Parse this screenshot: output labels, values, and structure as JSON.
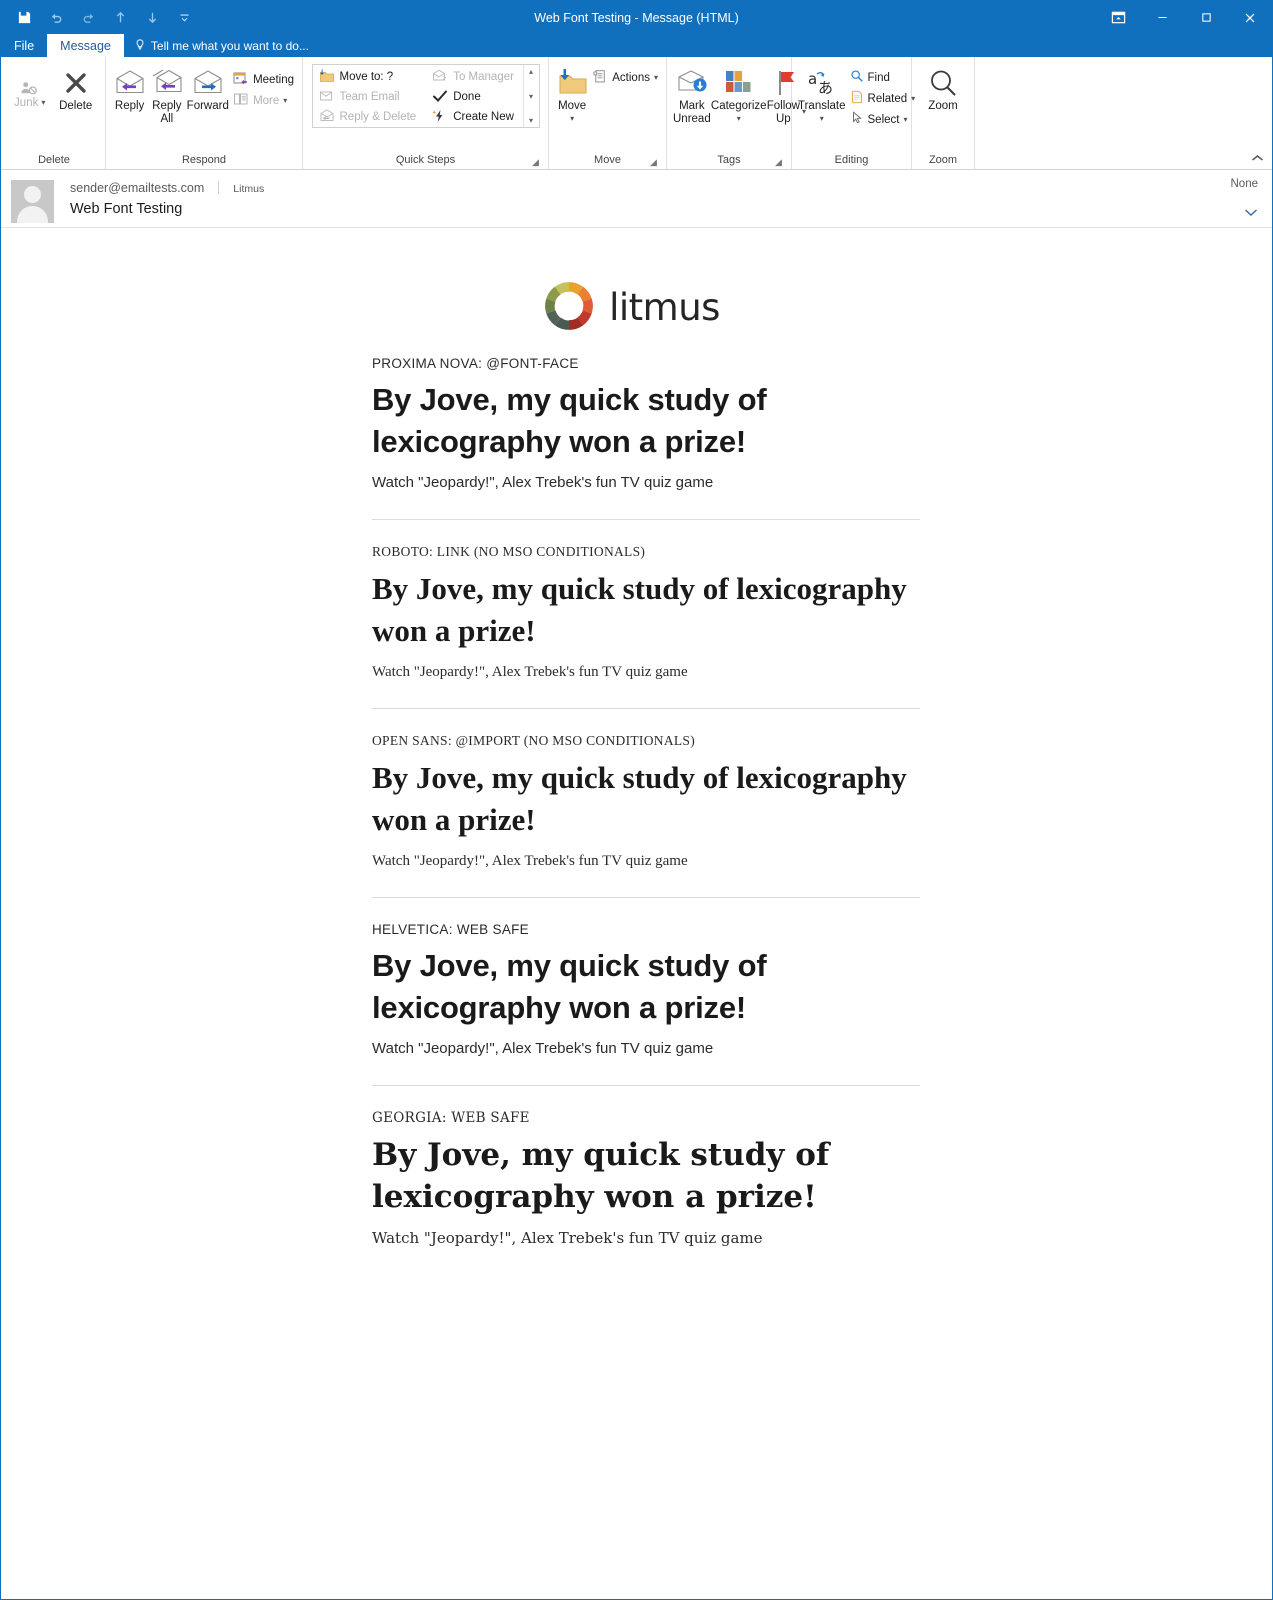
{
  "window": {
    "title": "Web Font Testing - Message (HTML)",
    "accent_color": "#1070bd"
  },
  "quick_access_toolbar": {
    "items": [
      {
        "name": "save-icon",
        "label": "Save"
      },
      {
        "name": "undo-icon",
        "label": "Undo"
      },
      {
        "name": "redo-icon",
        "label": "Redo"
      },
      {
        "name": "previous-item-icon",
        "label": "Previous Item"
      },
      {
        "name": "next-item-icon",
        "label": "Next Item"
      },
      {
        "name": "customize-qat-icon",
        "label": "Customize Quick Access Toolbar"
      }
    ]
  },
  "window_controls": {
    "restore_ribbon": "Ribbon Display Options",
    "minimize": "Minimize",
    "maximize": "Maximize",
    "close": "Close"
  },
  "tabs": [
    {
      "label": "File",
      "active": false
    },
    {
      "label": "Message",
      "active": true
    }
  ],
  "tell_me": {
    "placeholder": "Tell me what you want to do..."
  },
  "ribbon": {
    "collapse_label": "^",
    "groups": [
      {
        "name": "delete",
        "label": "Delete",
        "buttons": [
          {
            "label": "Junk",
            "icon": "junk-icon",
            "dimmed": true,
            "has_caret": true
          },
          {
            "label": "Delete",
            "icon": "delete-x-icon",
            "dimmed": false,
            "has_caret": false
          }
        ]
      },
      {
        "name": "respond",
        "label": "Respond",
        "buttons": [
          {
            "label": "Reply",
            "icon": "reply-icon"
          },
          {
            "label": "Reply\nAll",
            "icon": "reply-all-icon"
          },
          {
            "label": "Forward",
            "icon": "forward-icon"
          }
        ],
        "small_buttons": [
          {
            "label": "Meeting",
            "icon": "meeting-icon",
            "dimmed": false,
            "has_caret": false
          },
          {
            "label": "More",
            "icon": "more-icon",
            "dimmed": true,
            "has_caret": true
          }
        ]
      },
      {
        "name": "quick-steps",
        "label": "Quick Steps",
        "items_col1": [
          {
            "label": "Move to: ?",
            "icon": "move-to-folder-icon",
            "dimmed": false
          },
          {
            "label": "Team Email",
            "icon": "team-email-icon",
            "dimmed": true
          },
          {
            "label": "Reply & Delete",
            "icon": "reply-delete-icon",
            "dimmed": true
          }
        ],
        "items_col2": [
          {
            "label": "To Manager",
            "icon": "to-manager-icon",
            "dimmed": true
          },
          {
            "label": "Done",
            "icon": "done-check-icon",
            "dimmed": false
          },
          {
            "label": "Create New",
            "icon": "create-new-icon",
            "dimmed": false
          }
        ],
        "has_dialog_launcher": true
      },
      {
        "name": "move",
        "label": "Move",
        "buttons": [
          {
            "label": "Move",
            "icon": "move-folder-icon",
            "has_caret": true
          }
        ],
        "small_buttons": [
          {
            "label": "Actions",
            "icon": "actions-icon",
            "has_caret": true
          }
        ]
      },
      {
        "name": "tags",
        "label": "Tags",
        "buttons": [
          {
            "label": "Mark\nUnread",
            "icon": "mark-unread-icon"
          },
          {
            "label": "Categorize",
            "icon": "categorize-icon",
            "has_caret": true
          },
          {
            "label": "Follow\nUp",
            "icon": "follow-up-flag-icon",
            "has_caret": true
          }
        ],
        "has_dialog_launcher": true
      },
      {
        "name": "editing",
        "label": "Editing",
        "buttons": [
          {
            "label": "Translate",
            "icon": "translate-icon",
            "has_caret": true
          }
        ],
        "small_buttons": [
          {
            "label": "Find",
            "icon": "find-magnifier-icon",
            "has_caret": false
          },
          {
            "label": "Related",
            "icon": "related-icon",
            "has_caret": true
          },
          {
            "label": "Select",
            "icon": "select-cursor-icon",
            "has_caret": true
          }
        ]
      },
      {
        "name": "zoom",
        "label": "Zoom",
        "buttons": [
          {
            "label": "Zoom",
            "icon": "zoom-magnifier-icon"
          }
        ]
      }
    ]
  },
  "message_header": {
    "sender": "sender@emailtests.com",
    "recipient": "Litmus",
    "subject": "Web Font Testing",
    "flag_status": "None",
    "expand_label": "Expand"
  },
  "email": {
    "logo": {
      "wordmark": "litmus",
      "segment_colors": [
        "#e8a22e",
        "#eb8032",
        "#df5a35",
        "#c0392a",
        "#9e2d24",
        "#4a5a52",
        "#4f6356",
        "#6c8148",
        "#8d9a4a",
        "#c6c15a"
      ]
    },
    "sections": [
      {
        "kicker": "PROXIMA NOVA: @FONT-FACE",
        "headline": "By Jove, my quick study of lexicography won a prize!",
        "subline": "Watch \"Jeopardy!\", Alex Trebek's fun TV quiz game",
        "render_family": "sans"
      },
      {
        "kicker": "ROBOTO: LINK (NO MSO CONDITIONALS)",
        "headline": "By Jove, my quick study of lexicography won a prize!",
        "subline": "Watch \"Jeopardy!\", Alex Trebek's fun TV quiz game",
        "render_family": "serif"
      },
      {
        "kicker": "OPEN SANS: @IMPORT (NO MSO CONDITIONALS)",
        "headline": "By Jove, my quick study of lexicography won a prize!",
        "subline": "Watch \"Jeopardy!\", Alex Trebek's fun TV quiz game",
        "render_family": "serif"
      },
      {
        "kicker": "HELVETICA: WEB SAFE",
        "headline": "By Jove, my quick study of lexicography won a prize!",
        "subline": "Watch \"Jeopardy!\", Alex Trebek's fun TV quiz game",
        "render_family": "sans"
      },
      {
        "kicker": "GEORGIA: WEB SAFE",
        "headline": "By Jove, my quick study of lexicography won a prize!",
        "subline": "Watch \"Jeopardy!\", Alex Trebek's fun TV quiz game",
        "render_family": "dserif"
      }
    ]
  }
}
